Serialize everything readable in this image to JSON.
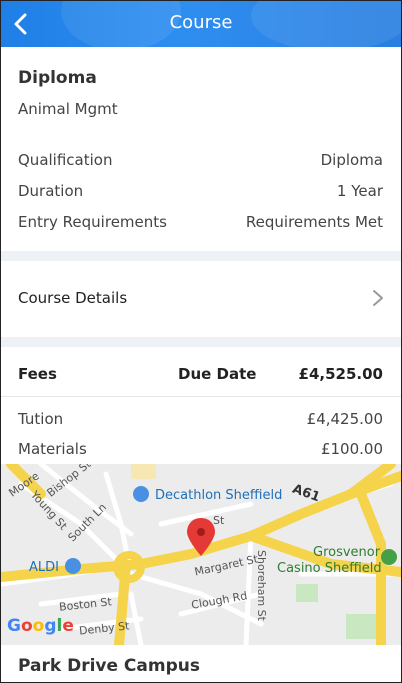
{
  "header": {
    "title": "Course",
    "back_icon": "back-chevron-icon"
  },
  "course": {
    "title": "Diploma",
    "subtitle": "Animal Mgmt"
  },
  "info_rows": [
    {
      "label": "Qualification",
      "value": "Diploma"
    },
    {
      "label": "Duration",
      "value": "1 Year"
    },
    {
      "label": "Entry Requirements",
      "value": "Requirements Met"
    }
  ],
  "details": {
    "label": "Course Details",
    "icon": "chevron-right-icon"
  },
  "fees": {
    "header": {
      "label": "Fees",
      "due_date": "Due Date",
      "total": "£4,525.00"
    },
    "items": [
      {
        "label": "Tution",
        "value": "£4,425.00"
      },
      {
        "label": "Materials",
        "value": "£100.00"
      }
    ]
  },
  "map": {
    "labels": {
      "moore": "Moore",
      "bishop": "Bishop St",
      "young": "Young St",
      "south": "South Ln",
      "st": "St",
      "margaret": "Margaret St",
      "shoreham": "Shoreham St",
      "boston": "Boston St",
      "clough": "Clough Rd",
      "denby": "Denby St",
      "road_a61": "A61"
    },
    "pois": {
      "decathlon": "Decathlon Sheffield",
      "aldi": "ALDI",
      "grosvenor_line1": "Grosvenor",
      "grosvenor_line2": "Casino Sheffield"
    },
    "logo": "Google",
    "colors": {
      "road": "#f5d34a",
      "bg": "#ececec",
      "pin": "#e53935",
      "poi_blue": "#1a73e8"
    }
  },
  "campus": {
    "name": "Park Drive Campus"
  },
  "colors": {
    "header": "#2a85ea",
    "divider": "#eef1f6"
  }
}
